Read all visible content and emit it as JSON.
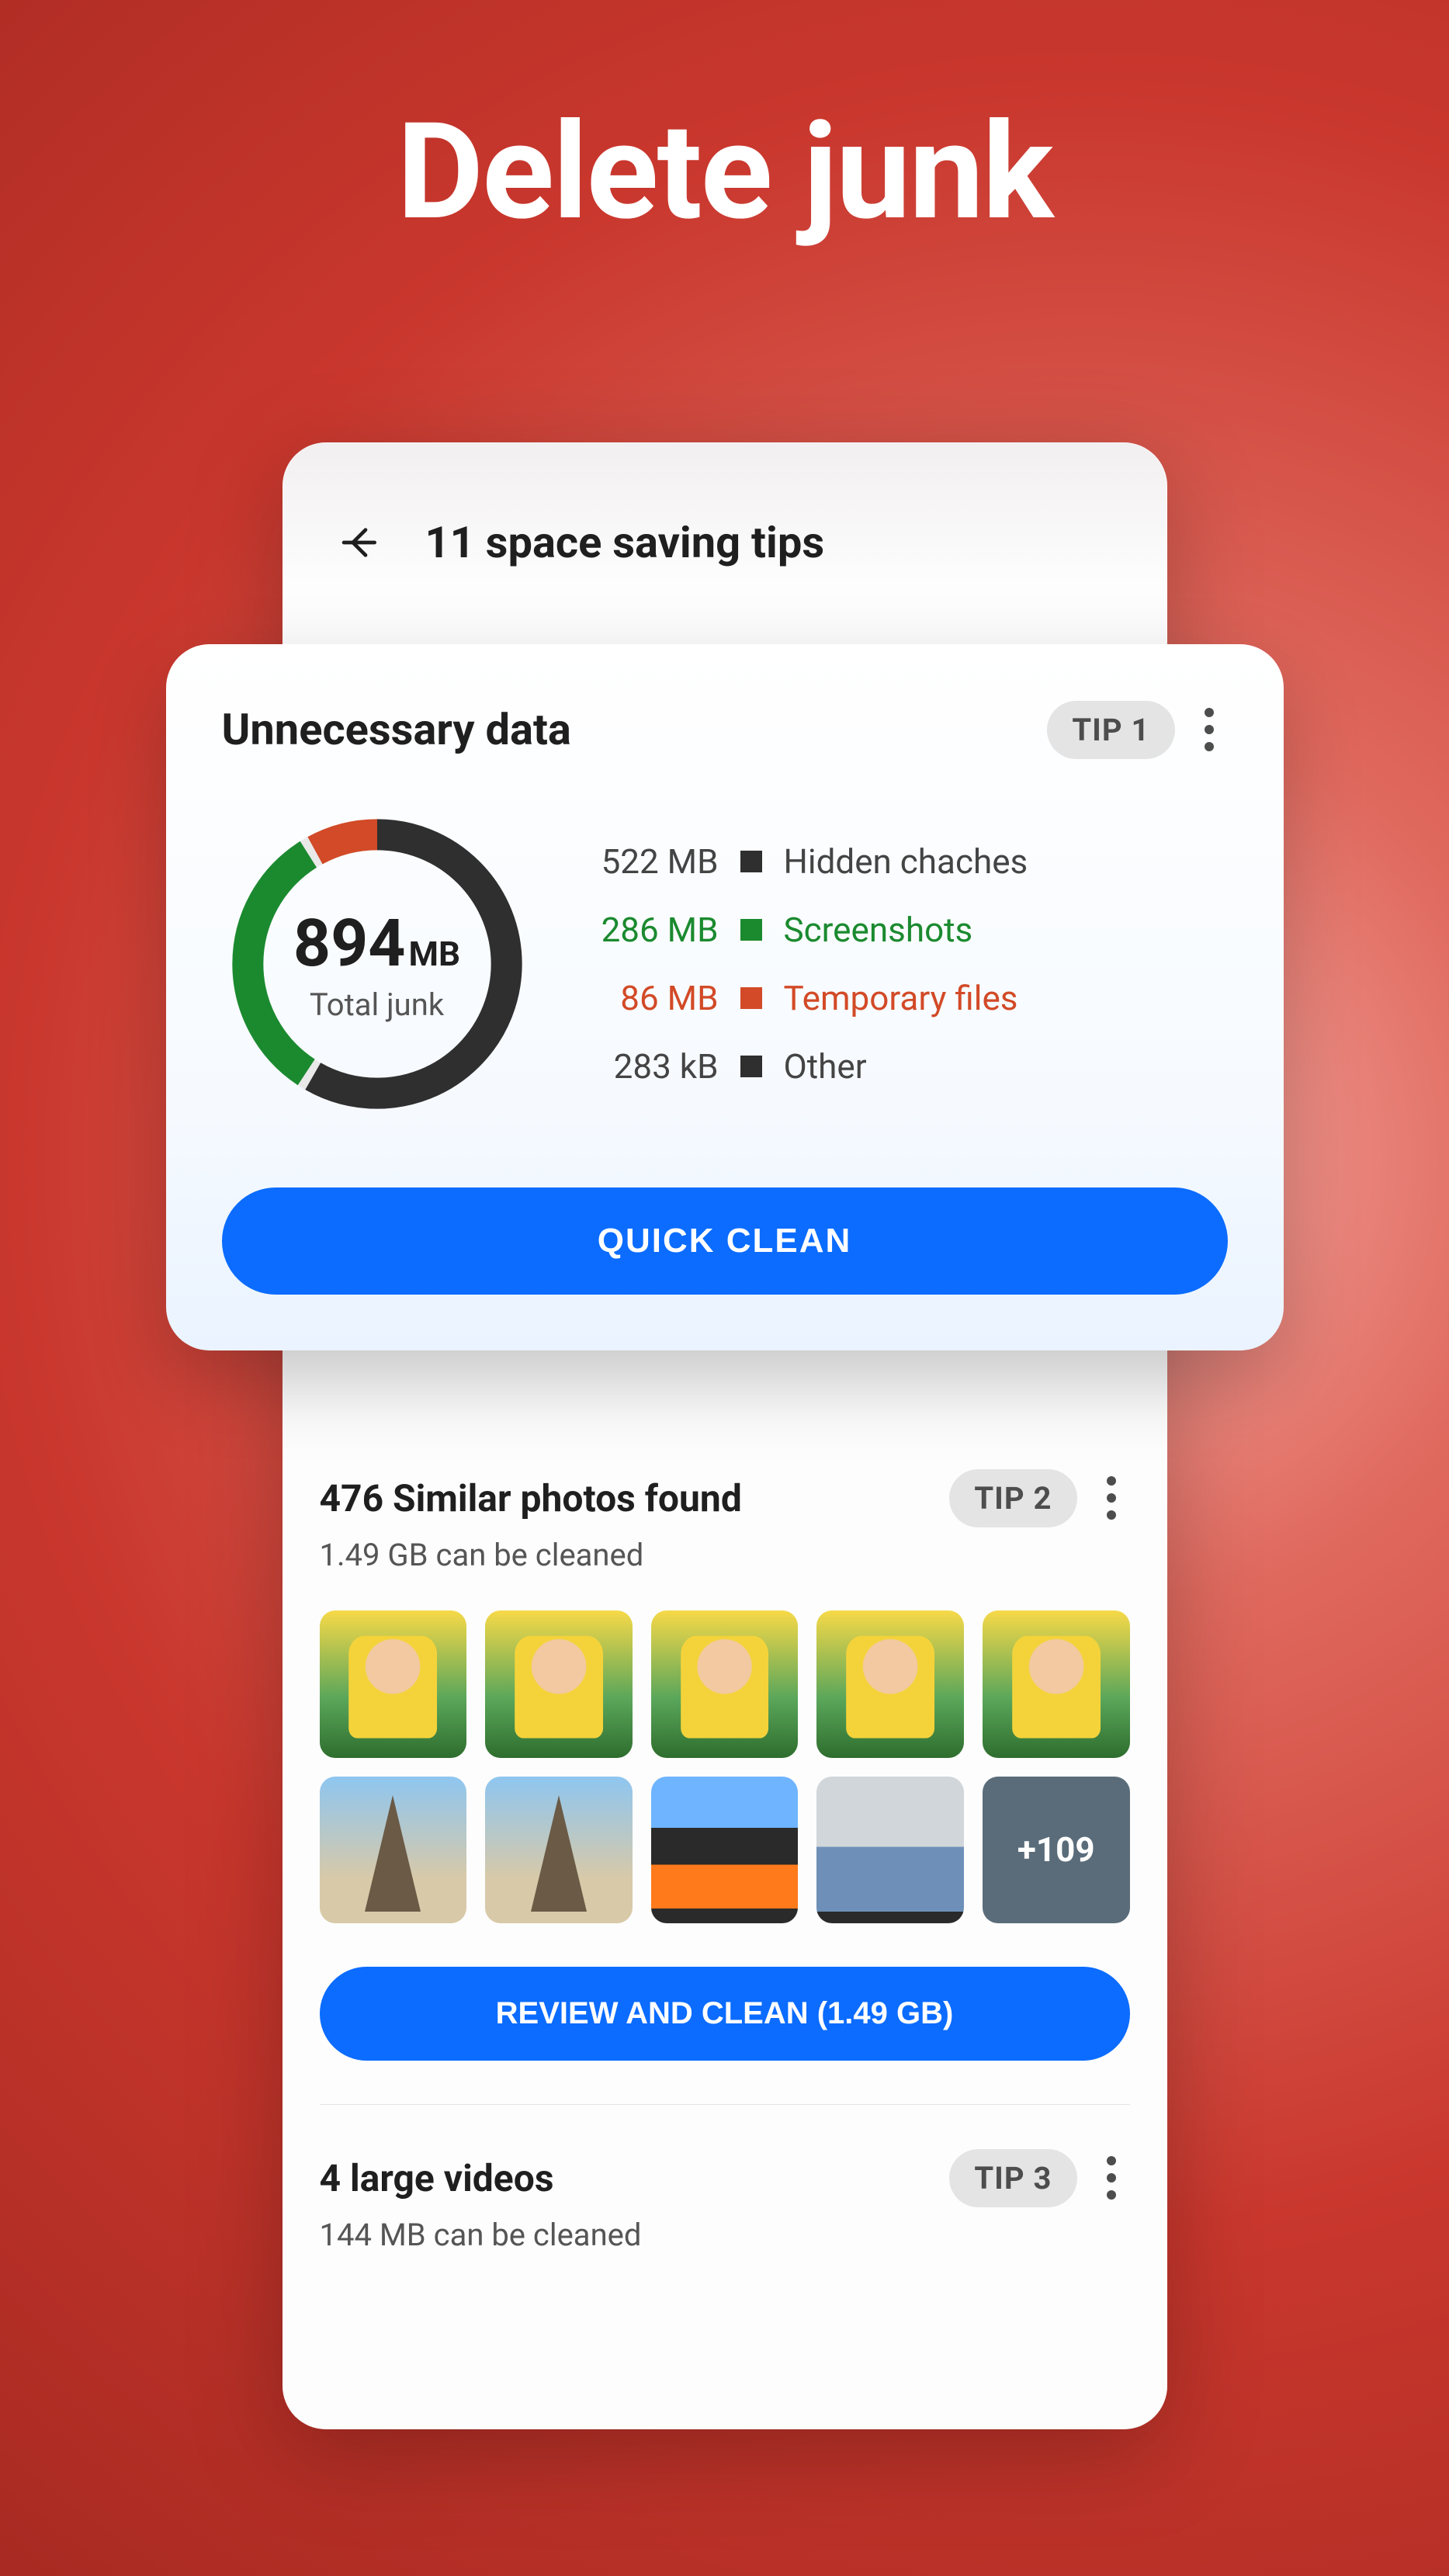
{
  "hero": {
    "title": "Delete junk"
  },
  "header": {
    "title": "11 space saving tips"
  },
  "tip1": {
    "title": "Unnecessary data",
    "badge": "TIP 1",
    "total_value": "894",
    "total_unit": "MB",
    "total_label": "Total junk",
    "cta": "QUICK CLEAN",
    "legend": [
      {
        "size": "522 MB",
        "color": "#2f2f2f",
        "label": "Hidden chaches"
      },
      {
        "size": "286 MB",
        "color": "#1b8a2f",
        "label": "Screenshots"
      },
      {
        "size": "86 MB",
        "color": "#d24a27",
        "label": "Temporary files"
      },
      {
        "size": "283 kB",
        "color": "#2f2f2f",
        "label": "Other"
      }
    ]
  },
  "tip2": {
    "title": "476 Similar photos found",
    "badge": "TIP 2",
    "subtitle": "1.49 GB can be cleaned",
    "cta": "REVIEW AND CLEAN (1.49 GB)",
    "overflow_label": "+109"
  },
  "tip3": {
    "title": "4 large videos",
    "badge": "TIP 3",
    "subtitle": "144 MB can be cleaned"
  },
  "chart_data": {
    "type": "pie",
    "title": "Total junk",
    "total": {
      "value": 894,
      "unit": "MB"
    },
    "series": [
      {
        "name": "Hidden chaches",
        "value": 522,
        "unit": "MB",
        "color": "#2f2f2f"
      },
      {
        "name": "Screenshots",
        "value": 286,
        "unit": "MB",
        "color": "#1b8a2f"
      },
      {
        "name": "Temporary files",
        "value": 86,
        "unit": "MB",
        "color": "#d24a27"
      },
      {
        "name": "Other",
        "value": 0.283,
        "unit": "MB",
        "color": "#2f2f2f"
      }
    ]
  }
}
